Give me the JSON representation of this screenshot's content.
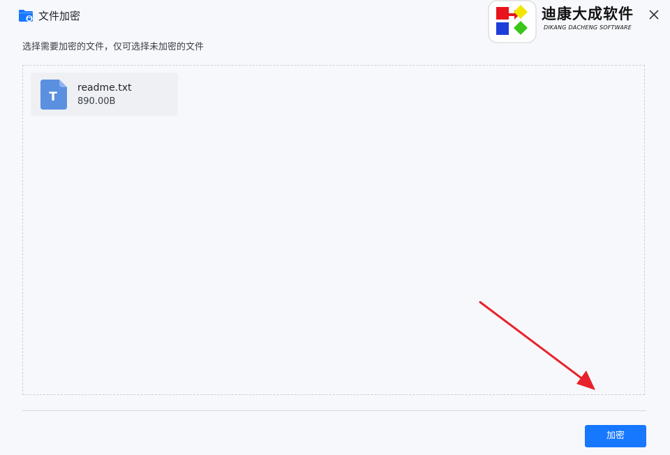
{
  "window": {
    "title": "文件加密",
    "close_icon": "close-icon",
    "title_icon": "folder-lock-icon"
  },
  "brand": {
    "name": "迪康大成软件",
    "subtitle": "DIKANG DACHENG SOFTWARE",
    "colors": {
      "red": "#e8141b",
      "yellow": "#f2e600",
      "blue": "#1d3fd8",
      "green": "#39c51a"
    }
  },
  "hint": "选择需要加密的文件，仅可选择未加密的文件",
  "files": [
    {
      "name": "readme.txt",
      "size": "890.00B",
      "icon": "text-file-icon",
      "icon_letter": "T"
    }
  ],
  "actions": {
    "encrypt_label": "加密"
  },
  "colors": {
    "accent": "#1677ff",
    "annotation_arrow": "#e8222a"
  }
}
